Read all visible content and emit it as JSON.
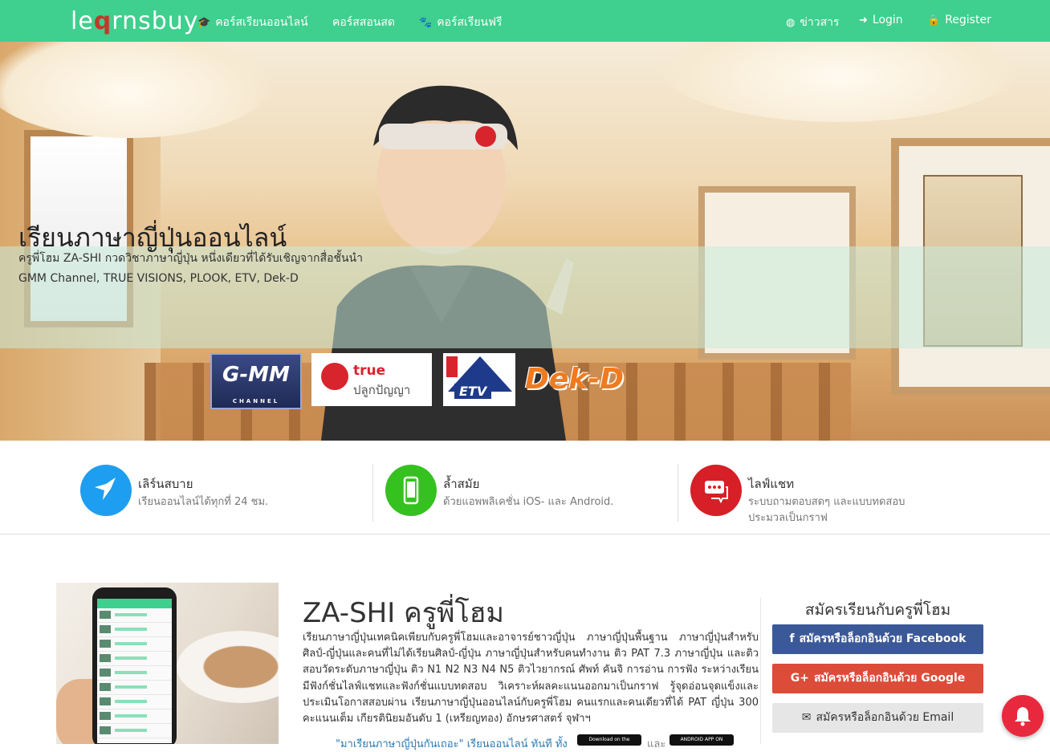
{
  "nav": {
    "logo": "learnsbuy",
    "items": [
      {
        "label": "คอร์สเรียนออนไลน์",
        "icon": "graduation-cap-icon"
      },
      {
        "label": "คอร์สสอนสด",
        "icon": ""
      },
      {
        "label": "คอร์สเรียนฟรี",
        "icon": "paw-icon"
      }
    ],
    "right": [
      {
        "label": "ข่าวสาร",
        "icon": "globe-icon"
      },
      {
        "label": "Login",
        "icon": "sign-in-icon"
      },
      {
        "label": "Register",
        "icon": "lock-icon"
      }
    ]
  },
  "hero": {
    "title": "เรียนภาษาญี่ปุ่นออนไลน์",
    "subtitle": "ครูพี่โฮม ZA-SHI กวดวิชาภาษาญี่ปุ่น หนึ่งเดียวที่ได้รับเชิญจากสื่อชั้นนำ GMM Channel, TRUE VISIONS, PLOOK, ETV, Dek-D",
    "partners": {
      "gmm": "G-MM",
      "gmm_small": "CHANNEL",
      "true_top": "true",
      "true_bottom": "ปลูกปัญญา",
      "etv": "ETV",
      "dekd": "Dek-D"
    }
  },
  "features": [
    {
      "title": "เลิร์นสบาย",
      "desc": "เรียนออนไลน์ได้ทุกที่ 24 ชม.",
      "icon": "bird-icon",
      "color": "#1e9ef0"
    },
    {
      "title": "ล้ำสมัย",
      "desc": "ด้วยแอพพลิเคชั่น iOS- และ Android.",
      "icon": "mobile-icon",
      "color": "#35c11f"
    },
    {
      "title": "ไลฟ์แชท",
      "desc": "ระบบถามตอบสดๆ และแบบทดสอบประมวลเป็นกราฟ",
      "icon": "chat-icon",
      "color": "#d61f26"
    }
  ],
  "main": {
    "heading": "ZA-SHI ครูพี่โฮม",
    "bio": "เรียนภาษาญี่ปุ่นเทคนิคเพียบกับครูพี่โฮมและอาจารย์ชาวญี่ปุ่น ภาษาญี่ปุ่นพื้นฐาน ภาษาญี่ปุ่นสำหรับศิลป์-ญี่ปุ่นและคนที่ไม่ได้เรียนศิลป์-ญี่ปุ่น ภาษาญี่ปุ่นสำหรับคนทำงาน ติว PAT 7.3 ภาษาญี่ปุ่น และติวสอบวัดระดับภาษาญี่ปุ่น ติว N1 N2 N3 N4 N5 ติวไวยากรณ์ ศัพท์ คันจิ การอ่าน การฟัง ระหว่างเรียนมีฟังก์ชั่นไลฟ์แชทและฟังก์ชั่นแบบทดสอบ วิเคราะห์ผลคะแนนออกมาเป็นกราฟ รู้จุดอ่อนจุดแข็งและประเมินโอกาสสอบผ่าน เรียนภาษาญี่ปุ่นออนไลน์กับครูพี่โฮม คนแรกและคนเดียวที่ได้ PAT ญี่ปุ่น 300 คะแนนเต็ม เกียรตินิยมอันดับ 1 (เหรียญทอง) อักษรศาสตร์ จุฬาฯ",
    "promo": "\"มาเรียนภาษาญี่ปุ่นกันเถอะ\" เรียนออนไลน์ ทันที ทั้ง",
    "app_store": "Download on the",
    "and": "และ",
    "play_store": "ANDROID APP ON"
  },
  "register": {
    "title": "สมัครเรียนกับครูพี่โฮม",
    "facebook": "สมัครหรือล็อกอินด้วย Facebook",
    "google": "สมัครหรือล็อกอินด้วย Google",
    "email": "สมัครหรือล็อกอินด้วย Email"
  },
  "colors": {
    "nav": "#3fcf8e",
    "facebook": "#3b5998",
    "google": "#dd4b39",
    "notification": "#e8283d"
  }
}
